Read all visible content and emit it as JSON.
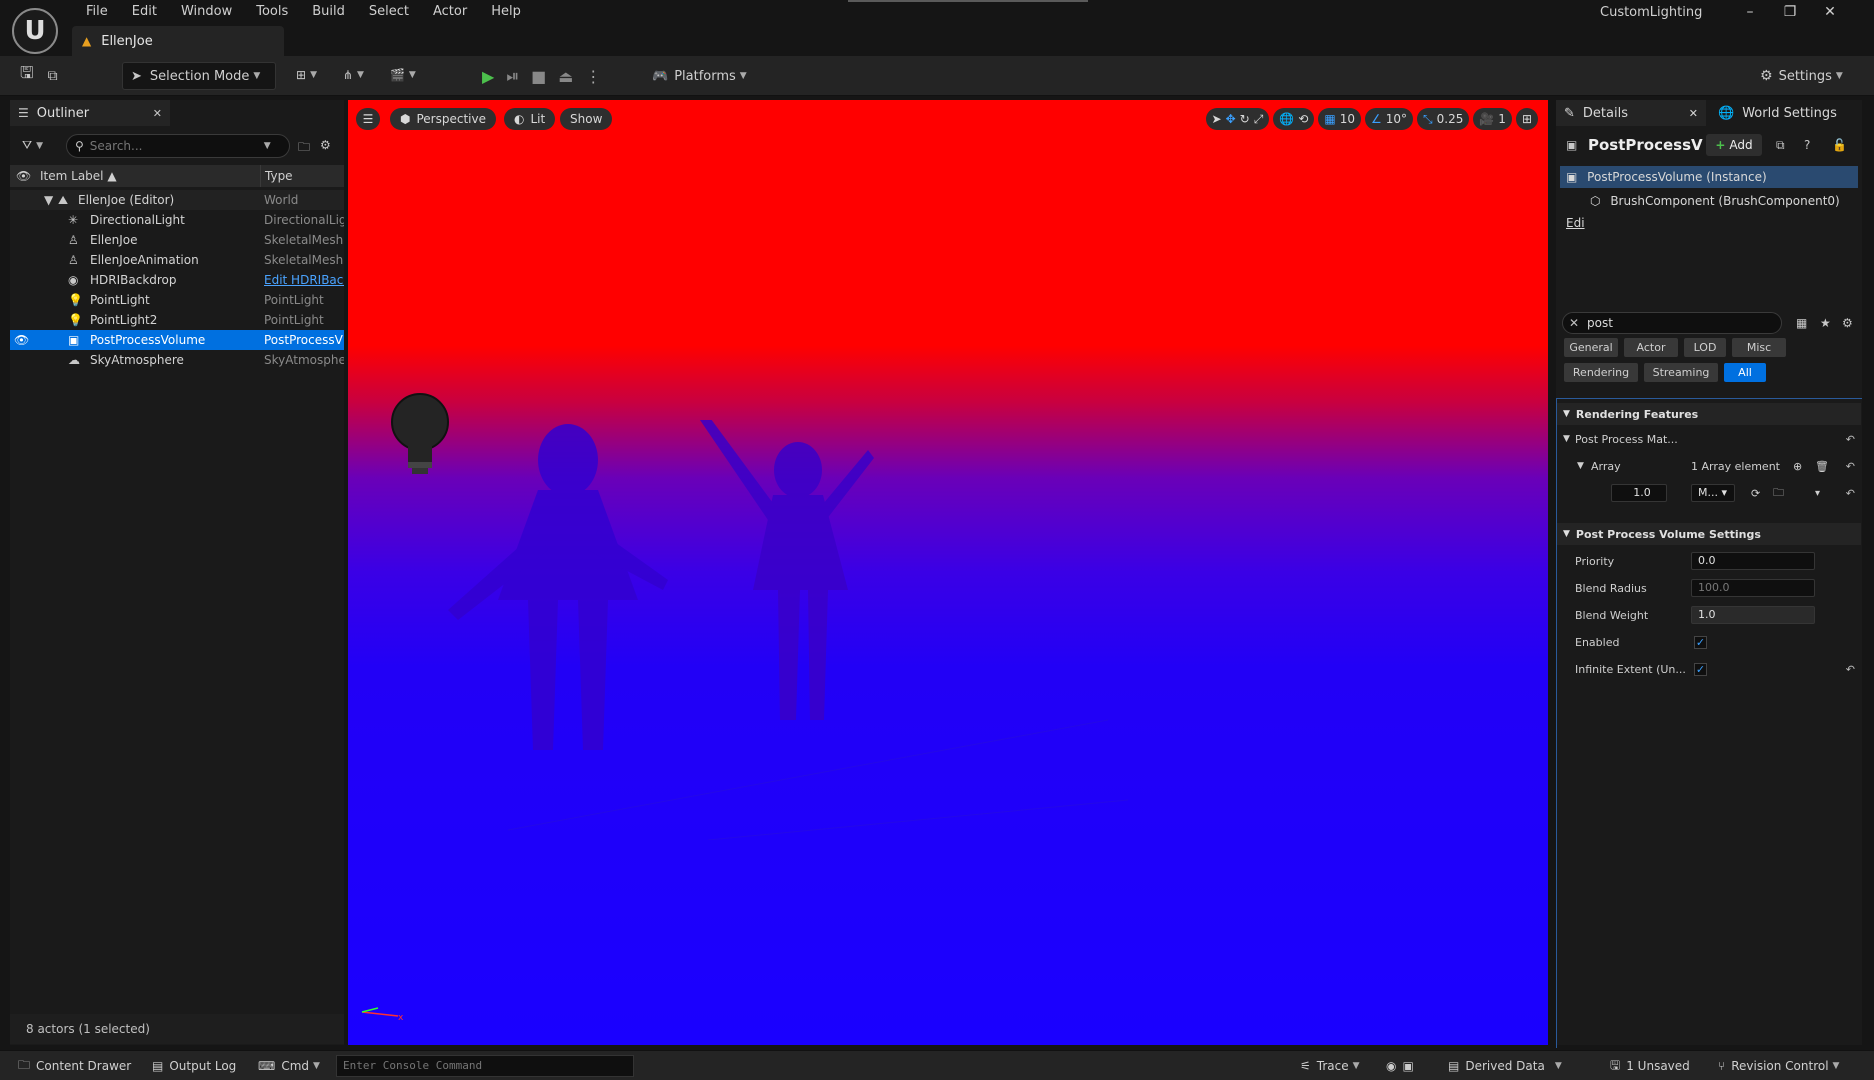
{
  "menu": [
    "File",
    "Edit",
    "Window",
    "Tools",
    "Build",
    "Select",
    "Actor",
    "Help"
  ],
  "doc_tab": "EllenJoe",
  "project_name": "CustomLighting",
  "toolbar": {
    "selection_mode": "Selection Mode",
    "platforms": "Platforms",
    "settings": "Settings"
  },
  "outliner": {
    "tab": "Outliner",
    "search_placeholder": "Search...",
    "col_label": "Item Label",
    "col_type": "Type",
    "root": {
      "name": "EllenJoe (Editor)",
      "type": "World"
    },
    "items": [
      {
        "name": "DirectionalLight",
        "type": "DirectionalLig",
        "icon": "sun-light-icon"
      },
      {
        "name": "EllenJoe",
        "type": "SkeletalMesh",
        "icon": "skeletal-mesh-icon"
      },
      {
        "name": "EllenJoeAnimation",
        "type": "SkeletalMesh",
        "icon": "skeletal-mesh-icon"
      },
      {
        "name": "HDRIBackdrop",
        "type": "Edit HDRIBacl",
        "icon": "sphere-icon"
      },
      {
        "name": "PointLight",
        "type": "PointLight",
        "icon": "bulb-icon"
      },
      {
        "name": "PointLight2",
        "type": "PointLight",
        "icon": "bulb-icon"
      },
      {
        "name": "PostProcessVolume",
        "type": "PostProcessV",
        "icon": "volume-icon"
      },
      {
        "name": "SkyAtmosphere",
        "type": "SkyAtmosphe",
        "icon": "sky-icon"
      }
    ],
    "status": "8 actors (1 selected)"
  },
  "viewport": {
    "perspective": "Perspective",
    "lit": "Lit",
    "show": "Show",
    "grid_snap": "10",
    "rot_snap": "10°",
    "scale_snap": "0.25",
    "camera_speed": "1"
  },
  "details": {
    "tab": "Details",
    "world_settings_tab": "World Settings",
    "actor_name": "PostProcessV",
    "add_label": "Add",
    "component_instance": "PostProcessVolume (Instance)",
    "component_brush": "BrushComponent (BrushComponent0)",
    "component_brush_edit": "Edi",
    "search_value": "post",
    "filters": [
      "General",
      "Actor",
      "LOD",
      "Misc",
      "Rendering",
      "Streaming",
      "All"
    ],
    "sections": {
      "rendering_features": "Rendering Features",
      "pp_materials": "Post Process Mat...",
      "array": "Array",
      "array_count": "1 Array element",
      "array_weight": "1.0",
      "array_mode": "M...",
      "pp_volume_settings": "Post Process Volume Settings"
    },
    "props": {
      "priority_label": "Priority",
      "priority_value": "0.0",
      "blend_radius_label": "Blend Radius",
      "blend_radius_value": "100.0",
      "blend_weight_label": "Blend Weight",
      "blend_weight_value": "1.0",
      "enabled_label": "Enabled",
      "infinite_label": "Infinite Extent (Un..."
    }
  },
  "bottombar": {
    "content_drawer": "Content Drawer",
    "output_log": "Output Log",
    "cmd": "Cmd",
    "console_placeholder": "Enter Console Command",
    "trace": "Trace",
    "derived_data": "Derived Data",
    "unsaved": "1 Unsaved",
    "revision_control": "Revision Control"
  },
  "colors": {
    "accent": "#0070e0",
    "viewport_top": "#ff0000",
    "viewport_bottom": "#1a00ff"
  }
}
